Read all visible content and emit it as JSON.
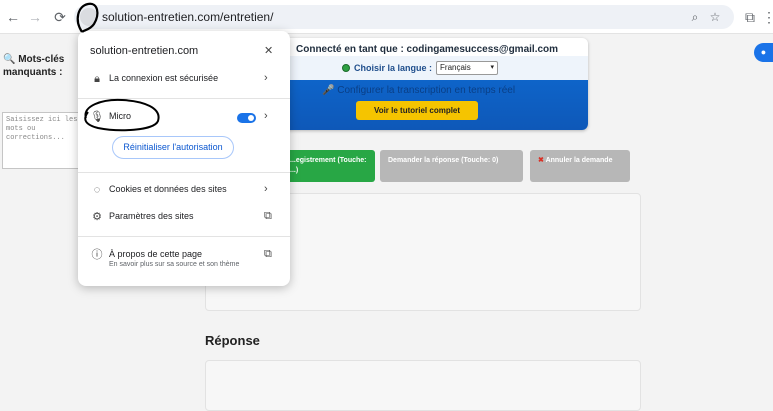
{
  "browser": {
    "url": "solution-entretien.com/entretien/",
    "back_icon": "←",
    "forward_icon": "→",
    "reload_icon": "⟳",
    "zoom_icon": "⌕",
    "star_icon": "☆",
    "extensions_icon": "⧉",
    "menu_icon": "⋮"
  },
  "site_popup": {
    "host": "solution-entretien.com",
    "close_icon": "✕",
    "connection_label": "La connexion est sécurisée",
    "mic_label": "Micro",
    "reset_label": "Réinitialiser l'autorisation",
    "cookies_label": "Cookies et données des sites",
    "site_settings_label": "Paramètres des sites",
    "about_label": "À propos de cette page",
    "about_sub": "En savoir plus sur sa source et son thème",
    "chevron": "›",
    "external_icon": "⧉",
    "mic_enabled": true
  },
  "left_panel": {
    "title_line1": "🔍 Mots-clés",
    "title_line2": "manquants :",
    "textarea_placeholder": "Saisissez ici les mots ou corrections..."
  },
  "header_panel": {
    "connected_text": "Connecté en tant que : codingamesuccess@gmail.com",
    "language_label": "Choisir la langue :",
    "language_value": "Français",
    "config_text": "🎤 Configurer la transcription en temps réel",
    "tutorial_label": "Voir le tutoriel complet"
  },
  "actions": {
    "record_label": "...egistrement (Touche: ...)",
    "ask_label": "Demander la réponse (Touche: 0)",
    "cancel_label": "Annuler la demande"
  },
  "response": {
    "title": "Réponse"
  },
  "colors": {
    "accent": "#1a73e8",
    "record_green": "#28a745",
    "disabled_gray": "#b7b7b7",
    "tutorial_yellow": "#f5c400",
    "panel_blue": "#0e64c9"
  }
}
